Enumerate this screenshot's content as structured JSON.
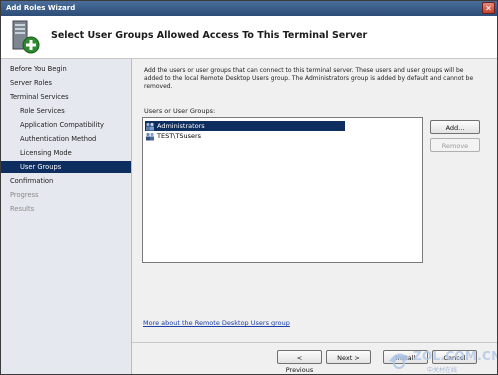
{
  "window": {
    "title": "Add Roles Wizard",
    "close_glyph": "✕"
  },
  "header": {
    "title": "Select User Groups Allowed Access To This Terminal Server"
  },
  "sidebar": {
    "items": [
      {
        "label": "Before You Begin",
        "level": 0,
        "state": "normal"
      },
      {
        "label": "Server Roles",
        "level": 0,
        "state": "normal"
      },
      {
        "label": "Terminal Services",
        "level": 0,
        "state": "normal"
      },
      {
        "label": "Role Services",
        "level": 1,
        "state": "normal"
      },
      {
        "label": "Application Compatibility",
        "level": 1,
        "state": "normal"
      },
      {
        "label": "Authentication Method",
        "level": 1,
        "state": "normal"
      },
      {
        "label": "Licensing Mode",
        "level": 1,
        "state": "normal"
      },
      {
        "label": "User Groups",
        "level": 1,
        "state": "active"
      },
      {
        "label": "Confirmation",
        "level": 0,
        "state": "normal"
      },
      {
        "label": "Progress",
        "level": 0,
        "state": "disabled"
      },
      {
        "label": "Results",
        "level": 0,
        "state": "disabled"
      }
    ]
  },
  "main": {
    "description": "Add the users or user groups that can connect to this terminal server. These users and user groups will be added to the local Remote Desktop Users group. The Administrators group is added by default and cannot be removed.",
    "list_label": "Users or User Groups:",
    "groups": [
      {
        "name": "Administrators",
        "selected": true
      },
      {
        "name": "TEST\\TSusers",
        "selected": false
      }
    ],
    "add_label": "Add...",
    "remove_label": "Remove",
    "link_text": "More about the Remote Desktop Users group"
  },
  "footer": {
    "previous_label": "< Previous",
    "next_label": "Next >",
    "install_label": "Install",
    "cancel_label": "Cancel"
  },
  "watermark": {
    "text": "ZOL.COM.CN",
    "sub": "中关村在线"
  },
  "colors": {
    "active_nav": "#0e2e5f",
    "link": "#1a3fa8",
    "titlebar": "#2d4c78"
  }
}
